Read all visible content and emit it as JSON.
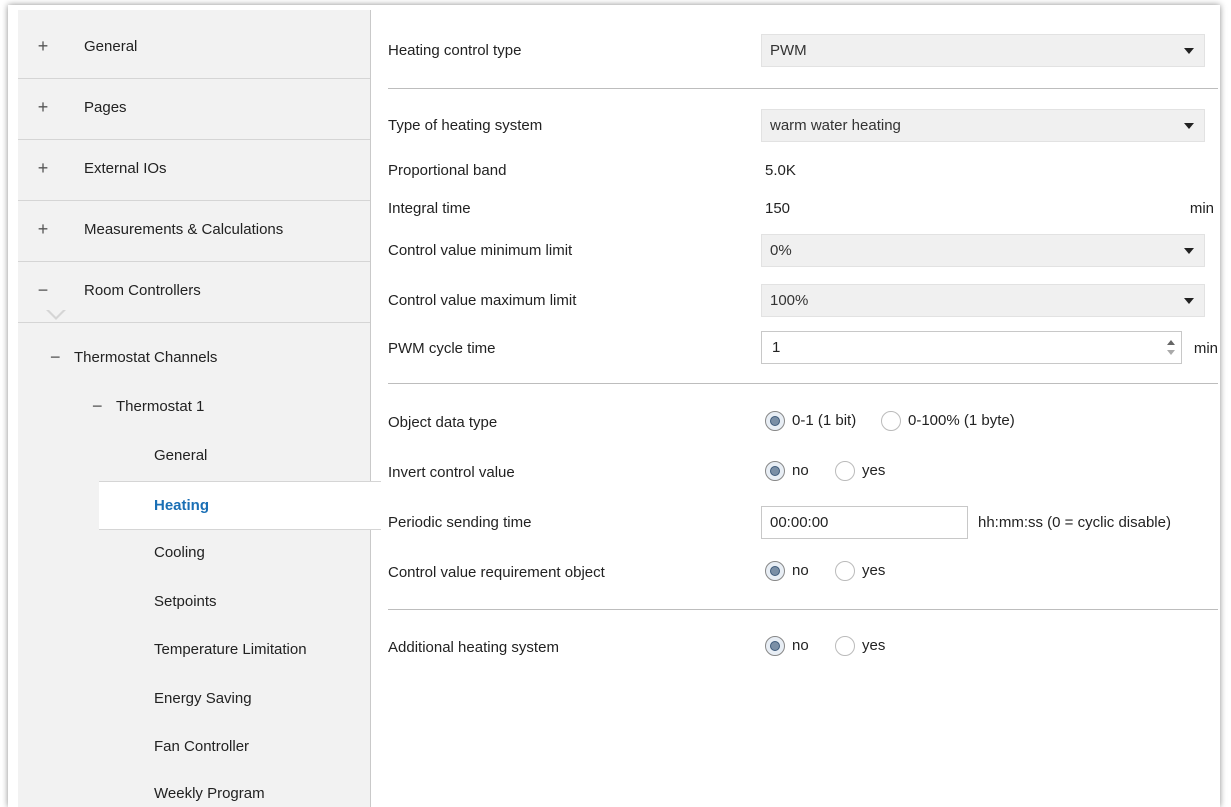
{
  "sidebar": {
    "groups": [
      {
        "sign": "+",
        "label": "General"
      },
      {
        "sign": "+",
        "label": "Pages"
      },
      {
        "sign": "+",
        "label": "External IOs"
      },
      {
        "sign": "+",
        "label": "Measurements & Calculations"
      },
      {
        "sign": "−",
        "label": "Room Controllers"
      }
    ],
    "thermostat_channels": {
      "sign": "−",
      "label": "Thermostat Channels"
    },
    "thermostat_1": {
      "sign": "−",
      "label": "Thermostat 1"
    },
    "items": [
      "General",
      "Heating",
      "Cooling",
      "Setpoints",
      "Temperature Limitation",
      "Energy Saving",
      "Fan Controller",
      "Weekly Program"
    ],
    "active_item": "Heating"
  },
  "main": {
    "heating_control_type": {
      "label": "Heating control type",
      "value": "PWM"
    },
    "type_of_heating_system": {
      "label": "Type of heating system",
      "value": "warm water heating"
    },
    "proportional_band": {
      "label": "Proportional band",
      "value": "5.0K"
    },
    "integral_time": {
      "label": "Integral time",
      "value": "150",
      "unit": "min"
    },
    "control_value_min": {
      "label": "Control value minimum limit",
      "value": "0%"
    },
    "control_value_max": {
      "label": "Control value maximum limit",
      "value": "100%"
    },
    "pwm_cycle_time": {
      "label": "PWM cycle time",
      "value": "1",
      "unit": "min"
    },
    "object_data_type": {
      "label": "Object data type",
      "options": [
        "0-1 (1 bit)",
        "0-100% (1 byte)"
      ],
      "selected": "0-1 (1 bit)"
    },
    "invert_control_value": {
      "label": "Invert control value",
      "options": [
        "no",
        "yes"
      ],
      "selected": "no"
    },
    "periodic_sending_time": {
      "label": "Periodic sending time",
      "value": "00:00:00",
      "unit": "hh:mm:ss (0 = cyclic disable)"
    },
    "control_value_requirement": {
      "label": "Control value requirement object",
      "options": [
        "no",
        "yes"
      ],
      "selected": "no"
    },
    "additional_heating_system": {
      "label": "Additional heating system",
      "options": [
        "no",
        "yes"
      ],
      "selected": "no"
    }
  },
  "colors": {
    "accent": "#1a6fb5",
    "sidebar_bg": "#f2f2f2"
  }
}
